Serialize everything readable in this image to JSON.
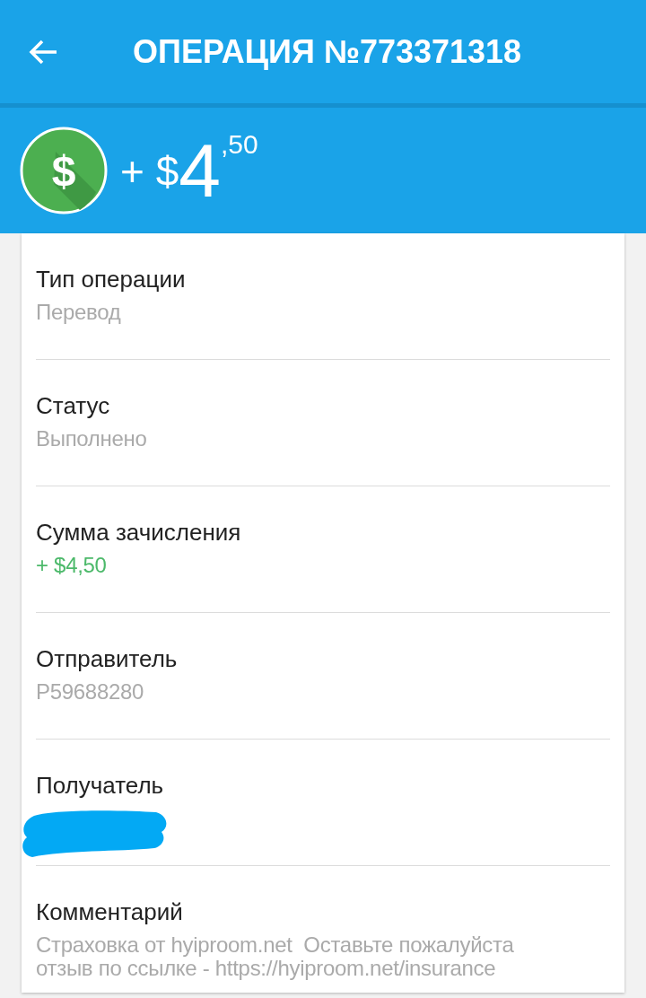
{
  "app_bar": {
    "title": "ОПЕРАЦИЯ №773371318"
  },
  "amount": {
    "icon_symbol": "$",
    "sign": "+ $",
    "whole": "4",
    "fraction": ",50"
  },
  "details": [
    {
      "label": "Тип операции",
      "value": "Перевод",
      "kind": "plain"
    },
    {
      "label": "Статус",
      "value": "Выполнено",
      "kind": "plain"
    },
    {
      "label": "Сумма зачисления",
      "value": "+ $4,50",
      "kind": "positive"
    },
    {
      "label": "Отправитель",
      "value": "P59688280",
      "kind": "plain"
    },
    {
      "label": "Получатель",
      "kind": "redacted"
    },
    {
      "label": "Комментарий",
      "value": "Страховка от hyiproom.net  Оставьте пожалуйста отзыв по ссылке - https://hyiproom.net/insurance",
      "kind": "plain"
    }
  ]
}
